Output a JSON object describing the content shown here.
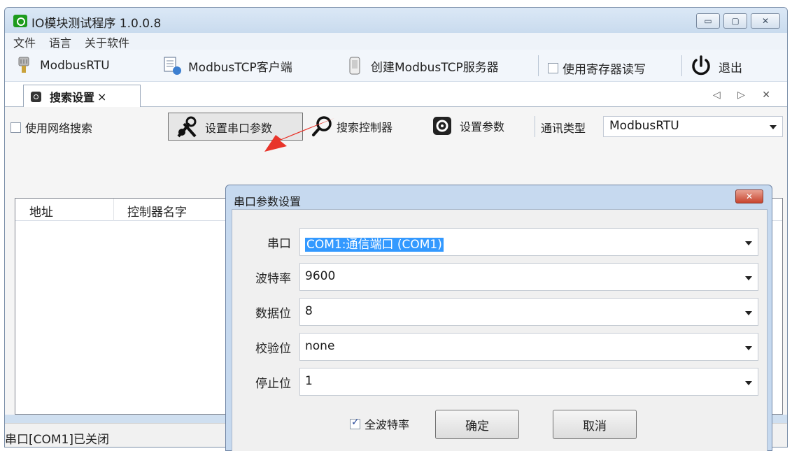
{
  "window": {
    "title": "IO模块测试程序 1.0.0.8",
    "buttons": {
      "minimize": "▭",
      "maximize": "▢",
      "close": "✕"
    }
  },
  "menu": [
    "文件",
    "语言",
    "关于软件"
  ],
  "toolbar": {
    "modbus_rtu": "ModbusRTU",
    "modbus_tcp_client": "ModbusTCP客户端",
    "create_tcp_server": "创建ModbusTCP服务器",
    "use_register": "使用寄存器读写",
    "exit": "退出"
  },
  "tab": {
    "label": "搜索设置",
    "close": "×",
    "nav": "◁ ▷ ✕"
  },
  "search_bar": {
    "use_network_search": "使用网络搜索",
    "set_serial_params": "设置串口参数",
    "search_controller": "搜索控制器",
    "set_params": "设置参数",
    "comm_type_label": "通讯类型",
    "comm_type_value": "ModbusRTU"
  },
  "table": {
    "columns": [
      "地址",
      "控制器名字"
    ]
  },
  "status": {
    "text": "串口[COM1]已关闭"
  },
  "dialog": {
    "title": "串口参数设置",
    "close": "✕",
    "fields": [
      {
        "label": "串口",
        "value": "COM1:通信端口 (COM1)"
      },
      {
        "label": "波特率",
        "value": "9600"
      },
      {
        "label": "数据位",
        "value": "8"
      },
      {
        "label": "校验位",
        "value": "none"
      },
      {
        "label": "停止位",
        "value": "1"
      }
    ],
    "all_baud": "全波特率",
    "all_baud_checked": true,
    "ok": "确定",
    "cancel": "取消"
  },
  "colors": {
    "annotation_arrow": "#e8342a",
    "selection": "#3399ff",
    "close_button": "#c7442e"
  }
}
